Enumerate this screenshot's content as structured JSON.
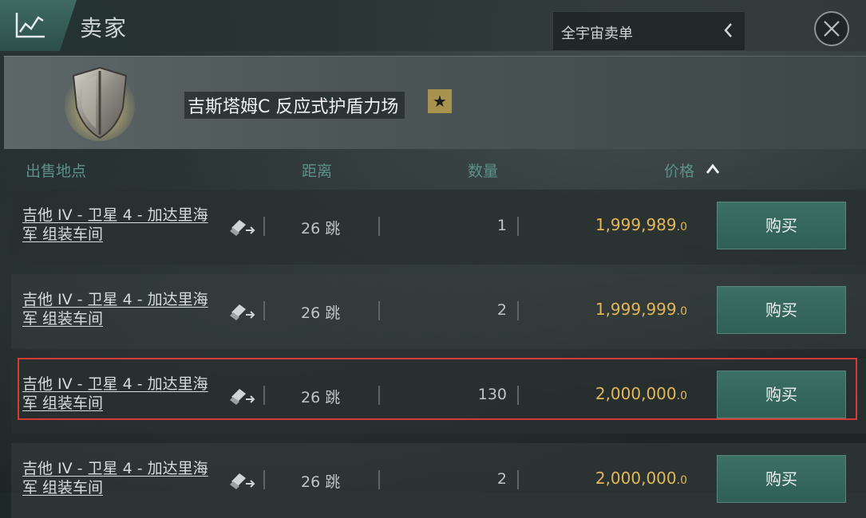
{
  "header": {
    "title": "卖家",
    "scope_label": "全宇宙卖单"
  },
  "item": {
    "name": "吉斯塔姆C 反应式护盾力场",
    "badge": "★"
  },
  "columns": {
    "location": "出售地点",
    "distance": "距离",
    "quantity": "数量",
    "price": "价格"
  },
  "orders": [
    {
      "location": "吉他 IV - 卫星 4 - 加达里海军 组装车间",
      "jumps": "26 跳",
      "quantity": "1",
      "price_int": "1,999,989",
      "price_dec": ".0",
      "buy_label": "购买"
    },
    {
      "location": "吉他 IV - 卫星 4 - 加达里海军 组装车间",
      "jumps": "26 跳",
      "quantity": "2",
      "price_int": "1,999,999",
      "price_dec": ".0",
      "buy_label": "购买"
    },
    {
      "location": "吉他 IV - 卫星 4 - 加达里海军 组装车间",
      "jumps": "26 跳",
      "quantity": "130",
      "price_int": "2,000,000",
      "price_dec": ".0",
      "buy_label": "购买"
    },
    {
      "location": "吉他 IV - 卫星 4 - 加达里海军 组装车间",
      "jumps": "26 跳",
      "quantity": "2",
      "price_int": "2,000,000",
      "price_dec": ".0",
      "buy_label": "购买"
    }
  ],
  "colors": {
    "accent": "#3c7065",
    "price": "#e3b658",
    "highlight": "#d83a3a",
    "header_text": "#5d9089"
  },
  "icons": {
    "header": "chart-icon",
    "close": "close-icon",
    "chevron": "chevron-left-icon",
    "waypoint": "set-destination-icon",
    "sort": "sort-ascending-icon",
    "item": "shield-icon"
  }
}
